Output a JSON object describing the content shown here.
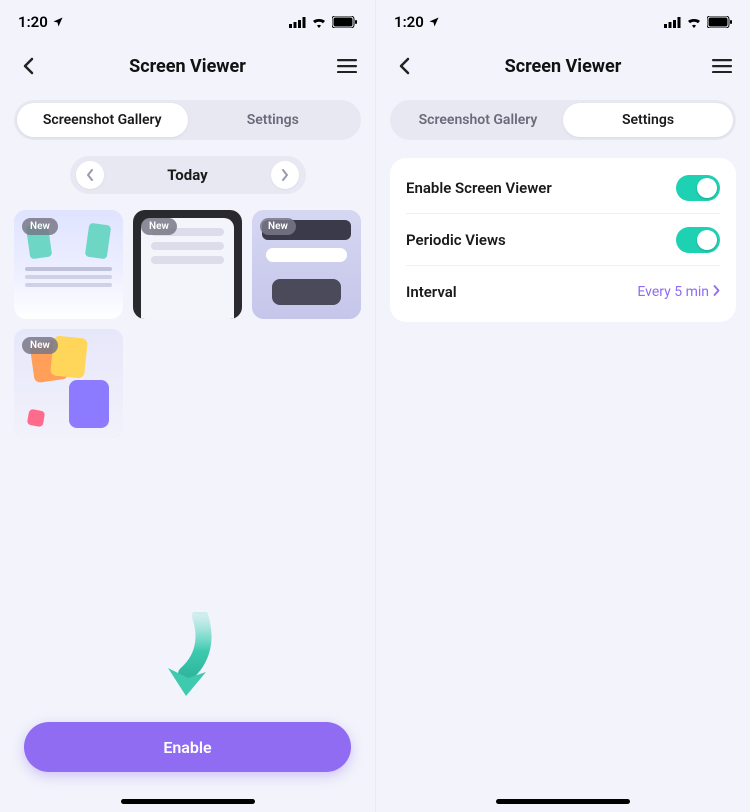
{
  "status": {
    "time": "1:20"
  },
  "nav": {
    "title": "Screen Viewer"
  },
  "tabs": {
    "gallery": "Screenshot Gallery",
    "settings": "Settings"
  },
  "date": {
    "label": "Today"
  },
  "badge": {
    "new": "New"
  },
  "cta": {
    "enable": "Enable"
  },
  "settings": {
    "enable_label": "Enable Screen Viewer",
    "periodic_label": "Periodic Views",
    "interval_label": "Interval",
    "interval_value": "Every 5 min"
  },
  "colors": {
    "accent_purple": "#8f6cf2",
    "toggle_teal": "#1fd1b3",
    "bg": "#f2f3fb"
  }
}
